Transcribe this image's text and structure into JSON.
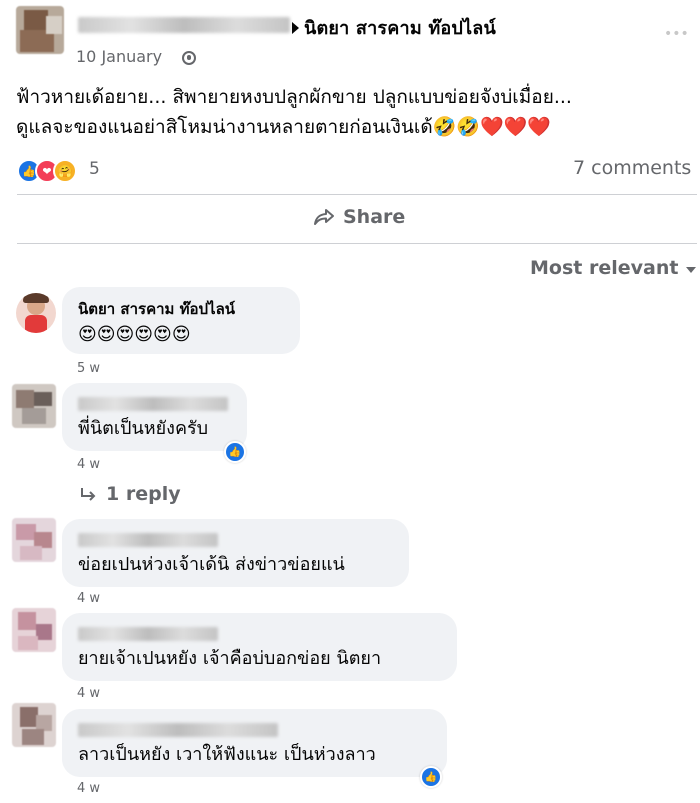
{
  "post": {
    "page_name": "นิตยา สารคาม ท๊อปไลน์",
    "date": "10 January",
    "audience_icon": "globe-icon",
    "text_line1": "ฟ้าวหายเด้อยาย... สิพายายหงบปลูกผักขาย ปลูกแบบข่อยจังบ่เมื่อย...",
    "text_line2": "ดูแลจะของแนอย่าสิโหมน่างานหลายตายก่อนเงินเด้🤣🤣❤️❤️❤️",
    "reaction_count": "5",
    "comments_count": "7 comments",
    "share_label": "Share"
  },
  "sort": {
    "label": "Most relevant"
  },
  "comments": [
    {
      "author": "นิตยา สารคาม ท๊อปไลน์",
      "text": "😍😍😍😍😍😍",
      "time": "5 w"
    },
    {
      "author": "",
      "text": "พี่นิตเป็นหยังครับ",
      "time": "4 w",
      "reply_label": "1 reply"
    },
    {
      "author": "",
      "text": "ข่อยเปนห่วงเจ้าเด้นิ ส่งข่าวข่อยแน่",
      "time": "4 w"
    },
    {
      "author": "",
      "text": "ยายเจ้าเปนหยัง เจ้าคือบ่บอกข่อย นิตยา",
      "time": "4 w"
    },
    {
      "author": "",
      "text": "ลาวเป็นหยัง เวาให้ฟังแนะ เป็นห่วงลาว",
      "time": "4 w"
    }
  ],
  "colors": {
    "accent": "#1b74e4",
    "secondary_text": "#65676b",
    "bubble": "#f0f2f5",
    "love": "#f33e58"
  }
}
